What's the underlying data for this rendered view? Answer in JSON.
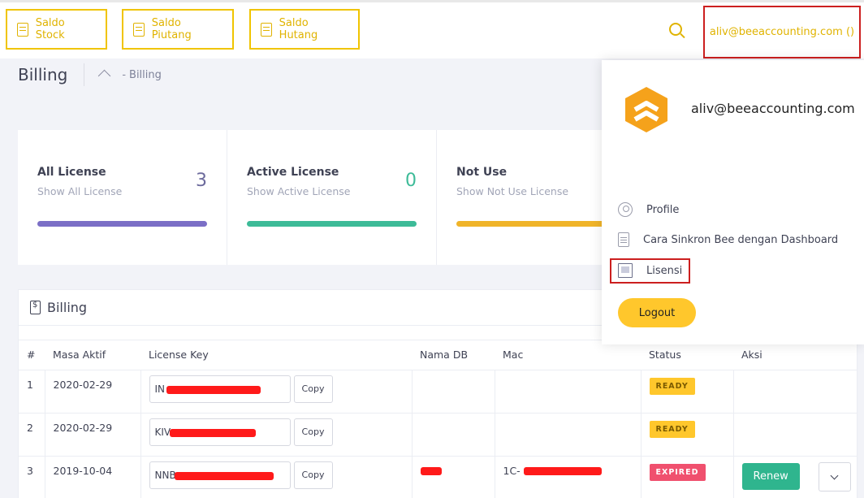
{
  "topbar": {
    "buttons": [
      {
        "label": "Saldo Stock",
        "icon": "document-icon"
      },
      {
        "label": "Saldo Piutang",
        "icon": "document-check-icon"
      },
      {
        "label": "Saldo Hutang",
        "icon": "document-icon"
      }
    ],
    "user_label": "aliv@beeaccounting.com ()",
    "accent_color": "#e0b300"
  },
  "subheader": {
    "title": "Billing",
    "breadcrumb": [
      "-",
      "Billing"
    ]
  },
  "stats": [
    {
      "title": "All License",
      "subtitle": "Show All License",
      "value": "3",
      "color": "#7b6fc6"
    },
    {
      "title": "Active License",
      "subtitle": "Show Active License",
      "value": "0",
      "color": "#3dbb98"
    },
    {
      "title": "Not Use",
      "subtitle": "Show Not Use License",
      "value": "",
      "color": "#f0b429"
    }
  ],
  "billing": {
    "title": "Billing",
    "columns": [
      "#",
      "Masa Aktif",
      "License Key",
      "Nama DB",
      "Mac",
      "Status",
      "Aksi"
    ],
    "copy_label": "Copy",
    "rows": [
      {
        "no": "1",
        "masa_aktif": "2020-02-29",
        "key_prefix": "IN",
        "nama_db": "",
        "mac": "",
        "status": "READY",
        "action": ""
      },
      {
        "no": "2",
        "masa_aktif": "2020-02-29",
        "key_prefix": "KIV",
        "nama_db": "",
        "mac": "",
        "status": "READY",
        "action": ""
      },
      {
        "no": "3",
        "masa_aktif": "2019-10-04",
        "key_prefix": "NNB",
        "nama_db": "",
        "mac": "1C-",
        "status": "EXPIRED",
        "action": "Renew"
      }
    ]
  },
  "dropdown": {
    "email": "aliv@beeaccounting.com",
    "items": [
      "Profile",
      "Cara Sinkron Bee dengan Dashboard",
      "Lisensi"
    ],
    "logout_label": "Logout"
  }
}
